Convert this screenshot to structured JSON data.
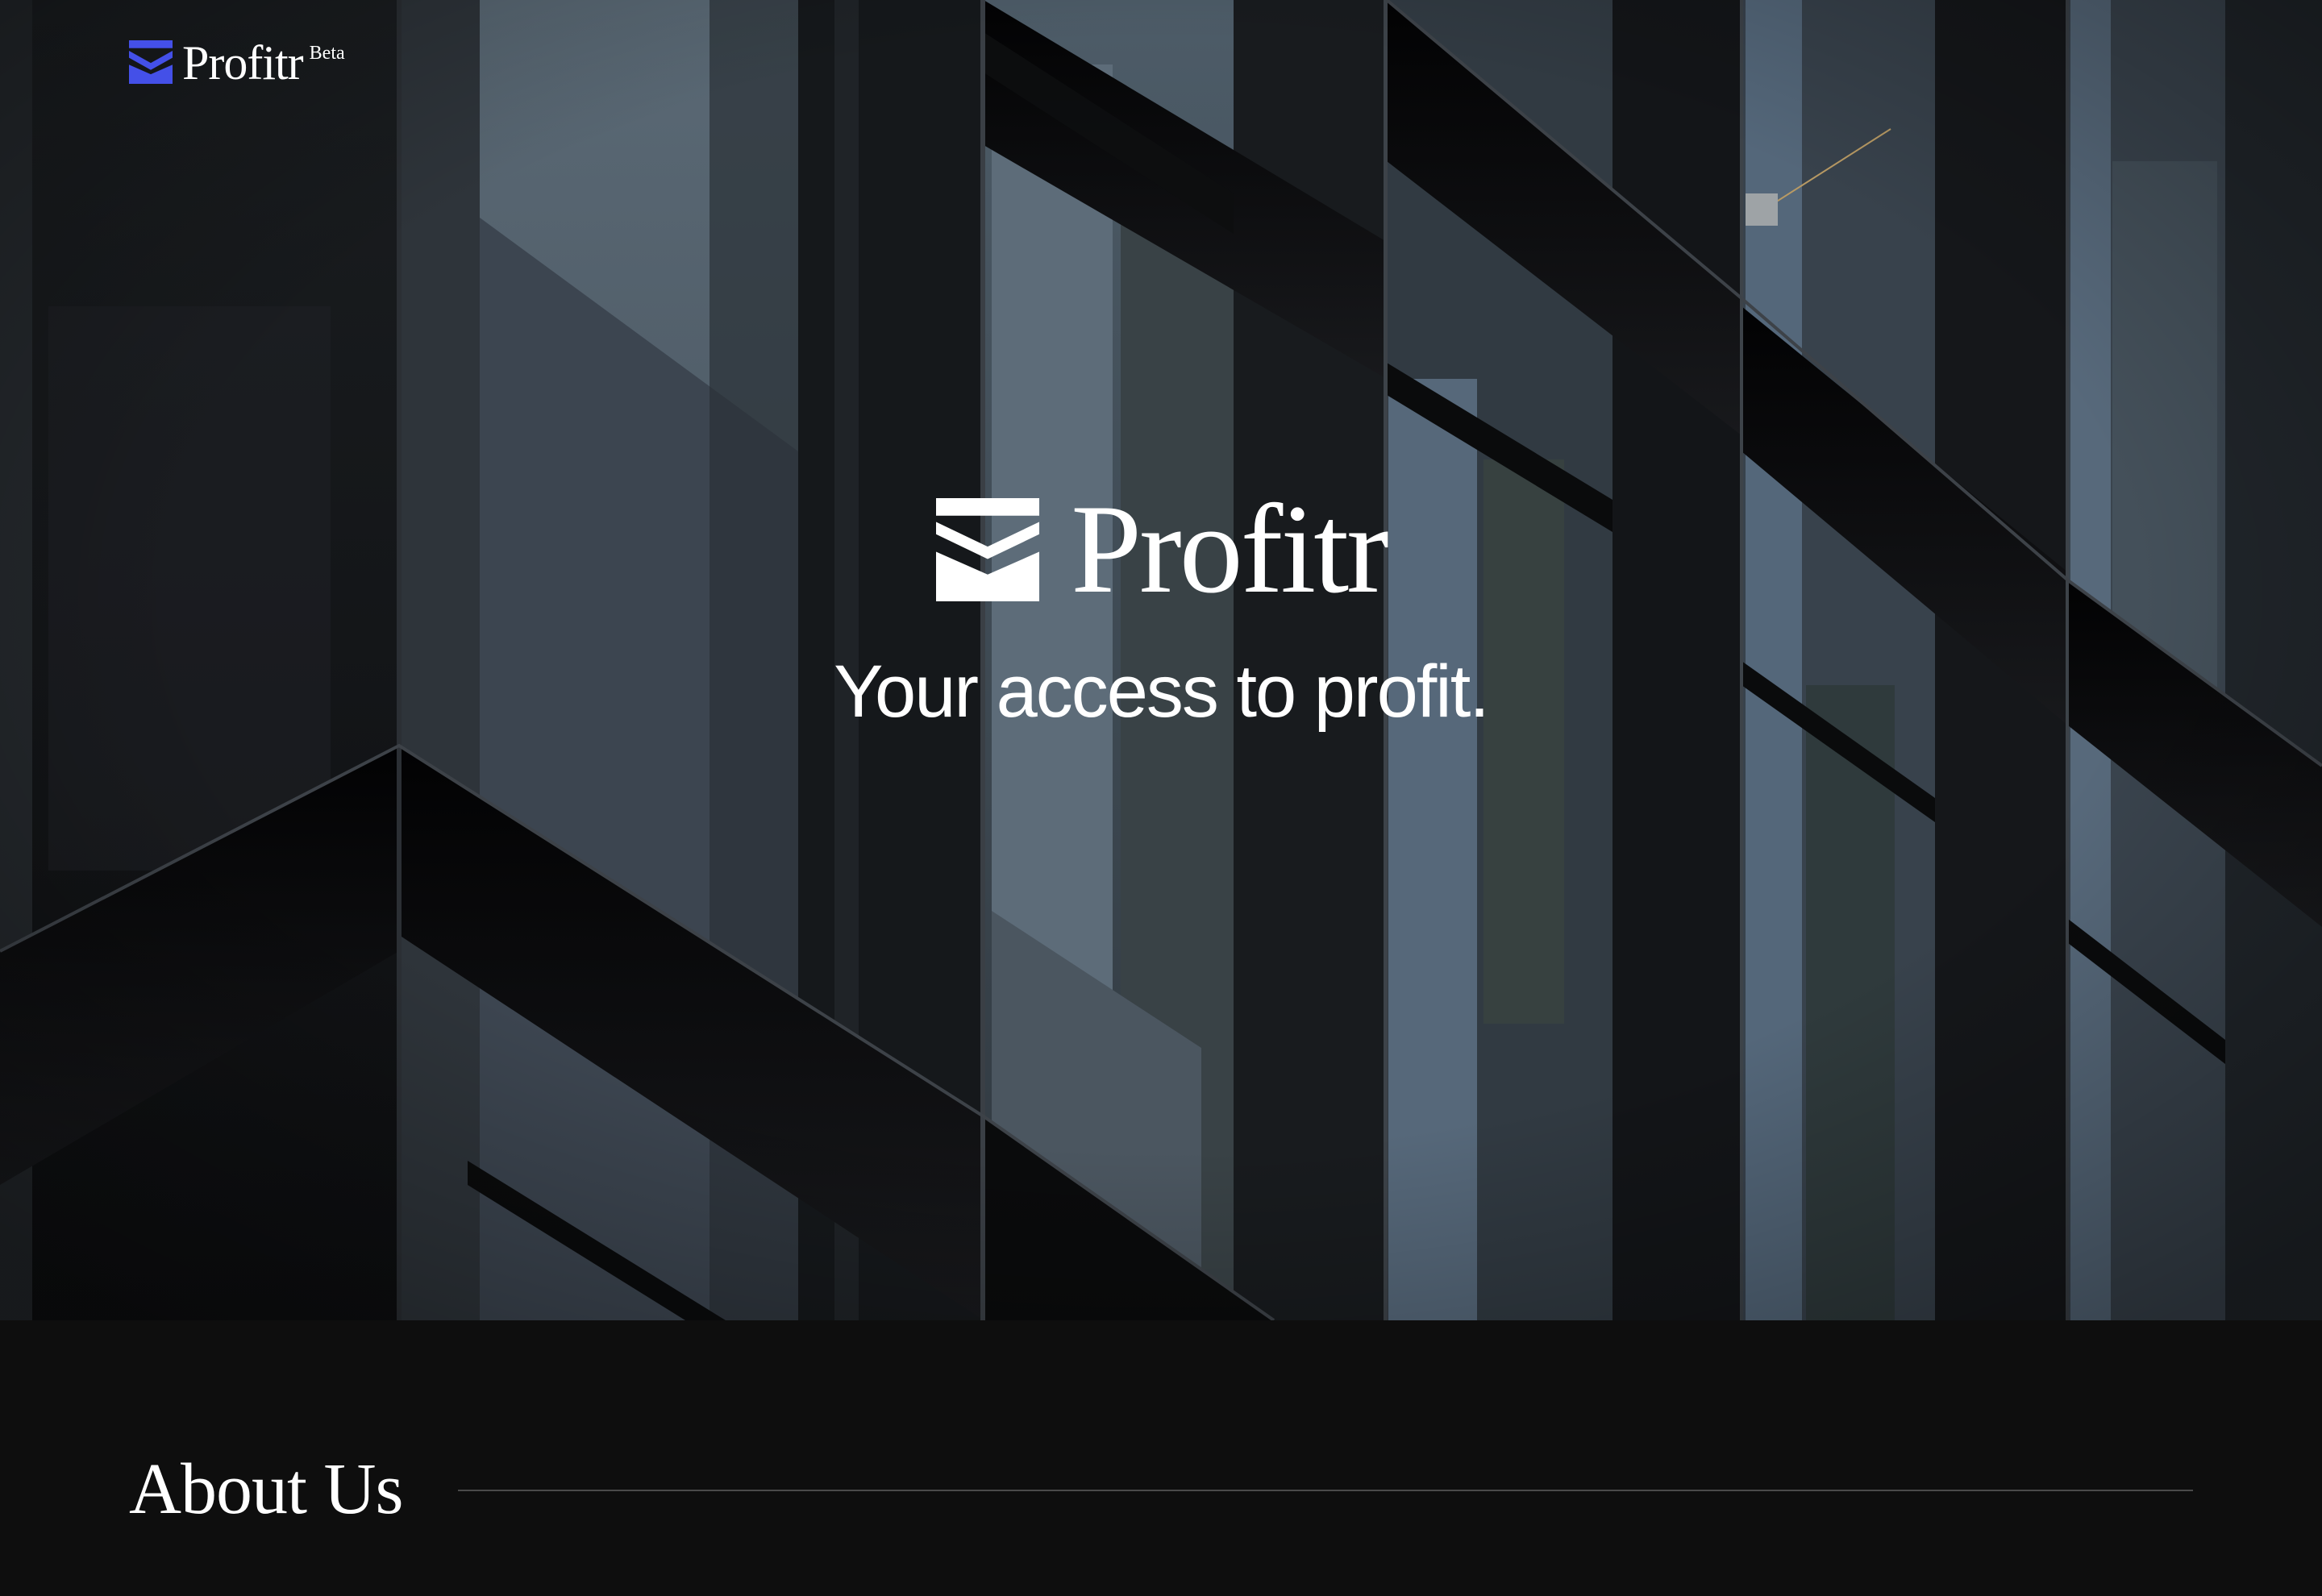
{
  "header": {
    "brand_name": "Profitr",
    "badge": "Beta",
    "logo_icon": "profitr-logo-icon",
    "logo_color": "#4450e8"
  },
  "hero": {
    "brand_name": "Profitr",
    "logo_icon": "profitr-logo-icon",
    "tagline": "Your access to profit.",
    "background": "dark-glass-building-facade"
  },
  "about": {
    "title": "About Us"
  },
  "colors": {
    "text": "#ffffff",
    "background": "#0e0e0e",
    "rule": "#4a4a4a"
  }
}
